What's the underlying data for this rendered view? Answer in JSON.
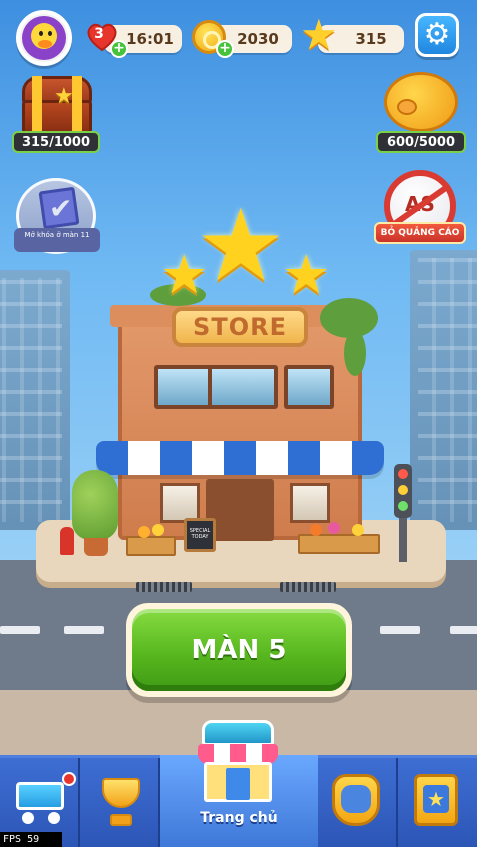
{
  "header": {
    "lives": "3",
    "life_timer": "16:01",
    "coins": "2030",
    "stars": "315"
  },
  "side": {
    "chest_progress": "315/1000",
    "piggy_progress": "600/5000",
    "unlock_label": "Mở khóa ở màn 11",
    "no_ads_label": "BỎ QUẢNG CÁO",
    "no_ads_badge": "AS"
  },
  "scene": {
    "store_sign": "STORE",
    "board_text": "SPECIAL TODAY"
  },
  "play_button": {
    "label": "MÀN 5"
  },
  "nav": {
    "home_label": "Trang chủ"
  },
  "debug": {
    "fps": "FPS 59"
  },
  "colors": {
    "play_green": "#58b71f",
    "nav_blue": "#2a56b8",
    "settings_blue": "#1f87e0",
    "progress_border": "#7ad046"
  },
  "icons": [
    "avatar-duck-icon",
    "heart-icon",
    "coin-icon",
    "star-icon",
    "settings-gear-icon",
    "treasure-chest-icon",
    "piggy-bank-icon",
    "unlock-book-icon",
    "no-ads-icon",
    "cart-icon",
    "trophy-icon",
    "shop-icon",
    "team-icon",
    "collection-book-icon"
  ]
}
